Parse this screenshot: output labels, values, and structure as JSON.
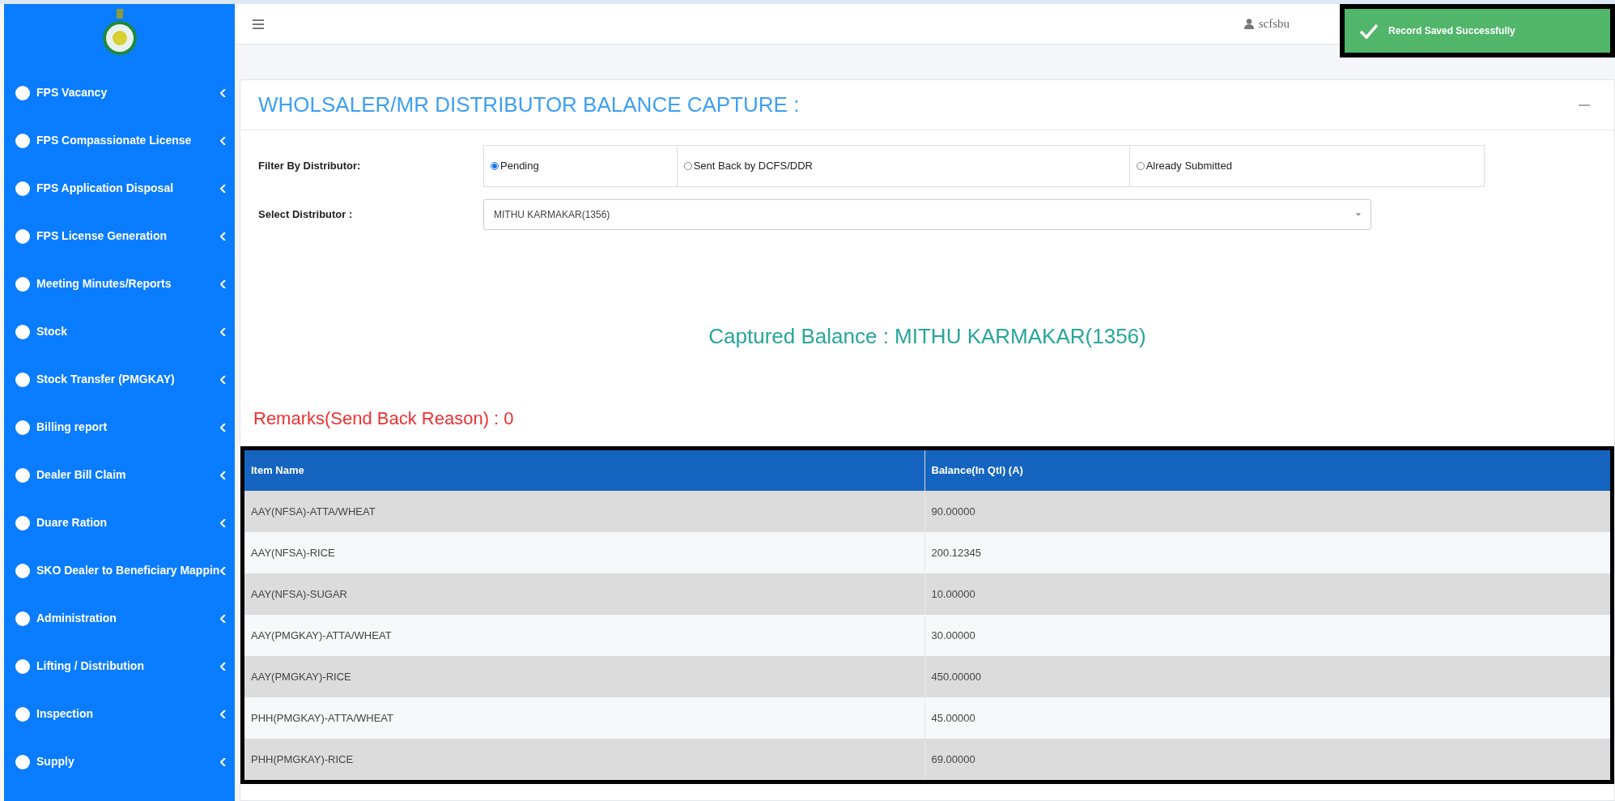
{
  "sidebar": {
    "items": [
      {
        "label": "FPS Vacancy",
        "expanded": false
      },
      {
        "label": "FPS Compassionate License",
        "expanded": false
      },
      {
        "label": "FPS Application Disposal",
        "expanded": false
      },
      {
        "label": "FPS License Generation",
        "expanded": false
      },
      {
        "label": "Meeting Minutes/Reports",
        "expanded": false
      },
      {
        "label": "Stock",
        "expanded": false
      },
      {
        "label": "Stock Transfer (PMGKAY)",
        "expanded": false
      },
      {
        "label": "Billing report",
        "expanded": false
      },
      {
        "label": "Dealer Bill Claim",
        "expanded": false
      },
      {
        "label": "Duare Ration",
        "expanded": false
      },
      {
        "label": "SKO Dealer to Beneficiary Mappin",
        "expanded": false
      },
      {
        "label": "Administration",
        "expanded": false
      },
      {
        "label": "Lifting / Distribution",
        "expanded": false
      },
      {
        "label": "Inspection",
        "expanded": false
      },
      {
        "label": "Supply",
        "expanded": false
      }
    ]
  },
  "topbar": {
    "user": "scfsbu"
  },
  "toast": {
    "message": "Record Saved Successfully"
  },
  "card": {
    "title": "WHOLSALER/MR DISTRIBUTOR BALANCE CAPTURE :",
    "filter": {
      "label": "Filter By Distributor:",
      "options": [
        {
          "label": "Pending",
          "selected": true
        },
        {
          "label": "Sent Back by DCFS/DDR",
          "selected": false
        },
        {
          "label": "Already Submitted",
          "selected": false
        }
      ]
    },
    "select": {
      "label": "Select Distributor :",
      "value": "MITHU KARMAKAR(1356)"
    },
    "captured": "Captured Balance : MITHU KARMAKAR(1356)",
    "remarks": "Remarks(Send Back Reason) : 0",
    "table": {
      "columns": [
        "Item Name",
        "Balance(In Qtl) (A)"
      ],
      "rows": [
        [
          "AAY(NFSA)-ATTA/WHEAT",
          "90.00000"
        ],
        [
          "AAY(NFSA)-RICE",
          "200.12345"
        ],
        [
          "AAY(NFSA)-SUGAR",
          "10.00000"
        ],
        [
          "AAY(PMGKAY)-ATTA/WHEAT",
          "30.00000"
        ],
        [
          "AAY(PMGKAY)-RICE",
          "450.00000"
        ],
        [
          "PHH(PMGKAY)-ATTA/WHEAT",
          "45.00000"
        ],
        [
          "PHH(PMGKAY)-RICE",
          "69.00000"
        ]
      ]
    }
  }
}
